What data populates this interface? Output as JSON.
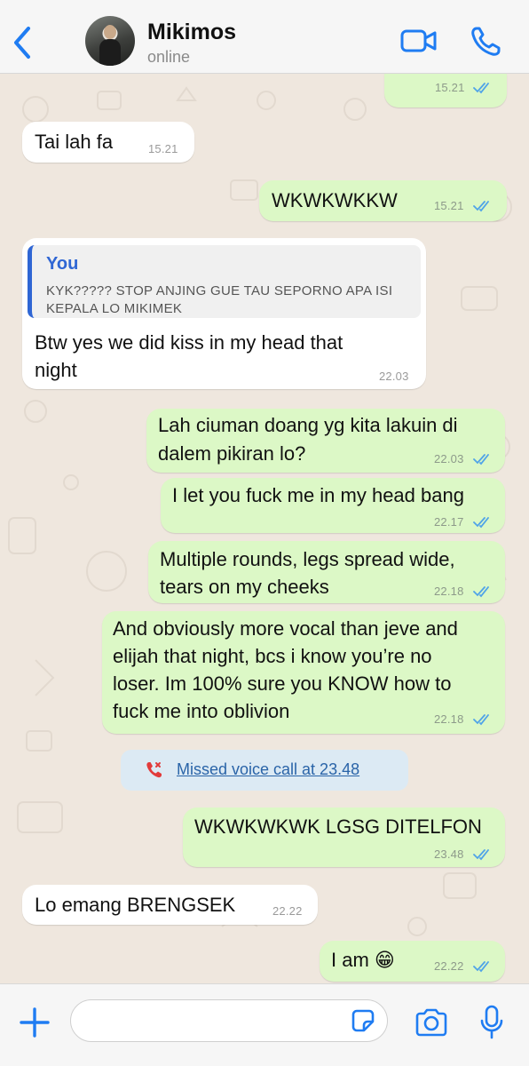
{
  "header": {
    "contact_name": "Mikimos",
    "status": "online"
  },
  "colors": {
    "accent": "#1f7cf2",
    "outgoing_bubble": "#dcf8c6",
    "incoming_bubble": "#ffffff",
    "read_ticks": "#4fa3e8",
    "missed_call": "#e23b3b"
  },
  "messages": [
    {
      "direction": "out",
      "text": "",
      "time": "15.21",
      "read": true
    },
    {
      "direction": "in",
      "text": "Tai lah fa",
      "time": "15.21"
    },
    {
      "direction": "out",
      "text": "WKWKWKKW",
      "time": "15.21",
      "read": true
    },
    {
      "direction": "in",
      "reply_to": {
        "author": "You",
        "text": "KYK????? STOP ANJING GUE TAU SEPORNO APA ISI KEPALA LO MIKIMEK"
      },
      "text_line1": "Btw yes we did kiss in my head that",
      "text_line2": "night",
      "time": "22.03"
    },
    {
      "direction": "out",
      "text_line1": "Lah ciuman doang yg kita lakuin di",
      "text_line2": "dalem pikiran lo?",
      "time": "22.03",
      "read": true
    },
    {
      "direction": "out",
      "text": "I let you fuck me in my head bang",
      "time": "22.17",
      "read": true
    },
    {
      "direction": "out",
      "text_line1": "Multiple rounds, legs spread wide,",
      "text_line2": "tears on my cheeks",
      "time": "22.18",
      "read": true
    },
    {
      "direction": "out",
      "text_line1": "And obviously more vocal than jeve and",
      "text_line2": "elijah that night, bcs i know you’re no",
      "text_line3": "loser. Im 100% sure you KNOW how to",
      "text_line4": "fuck me into oblivion",
      "time": "22.18",
      "read": true
    },
    {
      "direction": "system",
      "icon": "missed-call-icon",
      "text": "Missed voice call at 23.48"
    },
    {
      "direction": "out",
      "text": "WKWKWKWK LGSG DITELFON",
      "time": "23.48",
      "read": true
    },
    {
      "direction": "in",
      "text": "Lo emang BRENGSEK",
      "time": "22.22"
    },
    {
      "direction": "out",
      "text": "I am 😁",
      "time": "22.22",
      "read": true
    }
  ],
  "input": {
    "placeholder": "",
    "value": ""
  }
}
